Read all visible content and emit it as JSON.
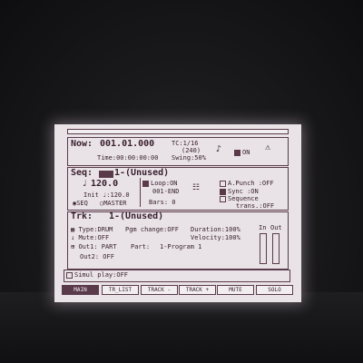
{
  "now": {
    "label": "Now:",
    "position": "001.01.000",
    "time": "Time:00:00:00:00"
  },
  "timing": {
    "tc": "TC:1/16",
    "tc_sub": "(240)",
    "swing": "Swing:50%",
    "metronome": "ON"
  },
  "seq": {
    "label": "Seq:",
    "name": "1-(Unused)",
    "tempo": "120.0",
    "init_tempo": "Init ♩:120.0",
    "seq_option": "SEQ",
    "master_option": "MASTER",
    "loop": "Loop:ON",
    "loop_range": "001-END",
    "bars": "Bars: 0",
    "auto_punch": "A.Punch :OFF",
    "sync": "Sync   :ON",
    "sequence_label": "Sequence",
    "trans": "trans.:OFF"
  },
  "trk": {
    "label": "Trk:",
    "name": "1-(Unused)",
    "type": "Type:DRUM",
    "pgm_change": "Pgm change:OFF",
    "duration": "Duration:100%",
    "mute": "Mute:OFF",
    "velocity": "Velocity:100%",
    "out1": "Out1: PART",
    "part": "Part:",
    "program": "1-Program 1",
    "out2": "Out2: OFF",
    "in_label": "In",
    "out_label": "Out"
  },
  "simul_play": "Simul play:OFF",
  "tabs": [
    "MAIN",
    "TR_LIST",
    "TRACK -",
    "TRACK +",
    "MUTE",
    "SOLO"
  ]
}
